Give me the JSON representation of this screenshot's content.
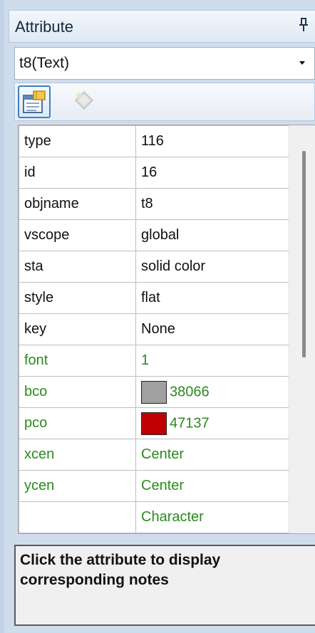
{
  "panel": {
    "title": "Attribute",
    "pin_icon": "pin-icon"
  },
  "object_selector": {
    "value": "t8(Text)",
    "arrow_icon": "dropdown-arrow-icon"
  },
  "toolbar": {
    "buttons": [
      {
        "icon": "properties-icon",
        "state": "active"
      },
      {
        "icon": "events-diamond-icon",
        "state": "disabled"
      }
    ]
  },
  "colors": {
    "green_text": "#2a8a1e",
    "bco_swatch": "#a0a0a0",
    "pco_swatch": "#c00000"
  },
  "attributes": {
    "rows": [
      {
        "name": "type",
        "value": "116"
      },
      {
        "name": "id",
        "value": "16"
      },
      {
        "name": "objname",
        "value": "t8"
      },
      {
        "name": "vscope",
        "value": "global"
      },
      {
        "name": "sta",
        "value": "solid color"
      },
      {
        "name": "style",
        "value": "flat"
      },
      {
        "name": "key",
        "value": "None"
      },
      {
        "name": "font",
        "value": "1"
      },
      {
        "name": "bco",
        "value": "38066"
      },
      {
        "name": "pco",
        "value": "47137"
      },
      {
        "name": "xcen",
        "value": "Center"
      },
      {
        "name": "ycen",
        "value": "Center"
      },
      {
        "name": "",
        "value": "Character"
      }
    ]
  },
  "notes": {
    "text": "Click the attribute to display corresponding notes"
  }
}
